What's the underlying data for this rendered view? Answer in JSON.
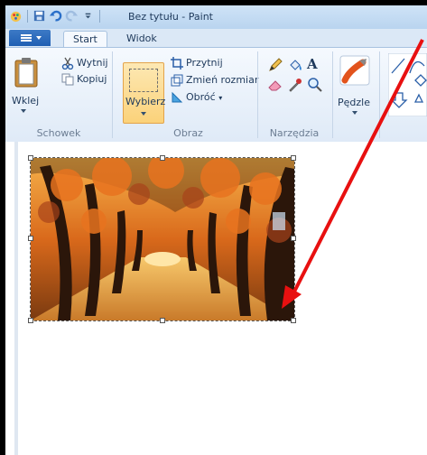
{
  "window": {
    "title": "Bez tytułu - Paint"
  },
  "tabs": [
    {
      "label": "Start",
      "active": true
    },
    {
      "label": "Widok",
      "active": false
    }
  ],
  "groups": {
    "clipboard": {
      "label": "Schowek",
      "paste": "Wklej",
      "cut": "Wytnij",
      "copy": "Kopiuj"
    },
    "image": {
      "label": "Obraz",
      "select": "Wybierz",
      "crop": "Przytnij",
      "resize": "Zmień rozmiar",
      "rotate": "Obróć"
    },
    "tools": {
      "label": "Narzędzia",
      "items": [
        "pencil-icon",
        "fill-icon",
        "text-icon",
        "eraser-icon",
        "color-picker-icon",
        "magnifier-icon"
      ]
    },
    "brushes": {
      "label": "Pędzle"
    }
  },
  "colors": {
    "annotation_arrow": "#e81010",
    "select_highlight": "#fbd27a"
  }
}
